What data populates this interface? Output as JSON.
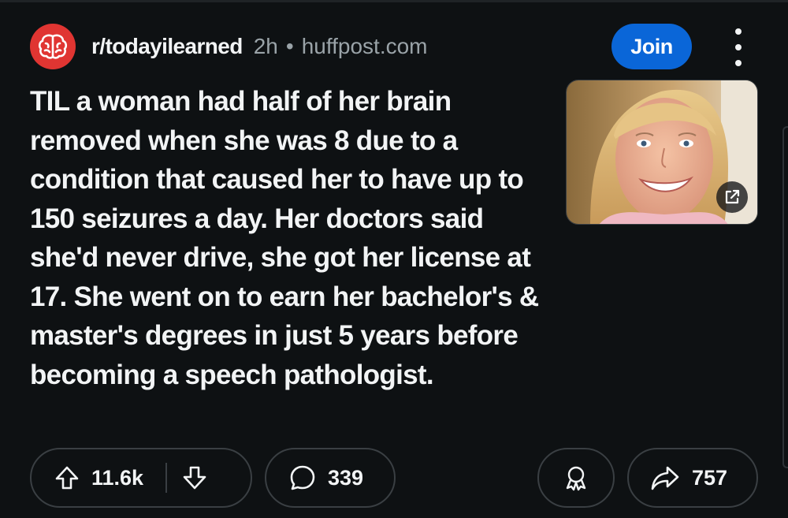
{
  "post": {
    "subreddit": "r/todayilearned",
    "time_ago": "2h",
    "separator": "•",
    "domain": "huffpost.com",
    "join_label": "Join",
    "title": "TIL a woman had half of her brain removed when she was 8 due to a condition that caused her to have up to 150 seizures a day. Her doctors said she'd never drive, she got her license at 17. She went on to earn her bachelor's & master's degrees in just 5 years before becoming a speech pathologist."
  },
  "actions": {
    "score": "11.6k",
    "comments": "339",
    "shares": "757"
  },
  "icons": {
    "subreddit_avatar": "brain-icon",
    "more": "more-vertical-icon",
    "external_link": "external-link-icon",
    "upvote": "arrow-up-icon",
    "downvote": "arrow-down-icon",
    "comment": "comment-bubble-icon",
    "award": "award-icon",
    "share": "share-arrow-icon"
  },
  "colors": {
    "background": "#0e1113",
    "join_button": "#0a66d8",
    "avatar": "#e03532",
    "muted_text": "#9aa3a8",
    "border": "#3a3f43"
  }
}
